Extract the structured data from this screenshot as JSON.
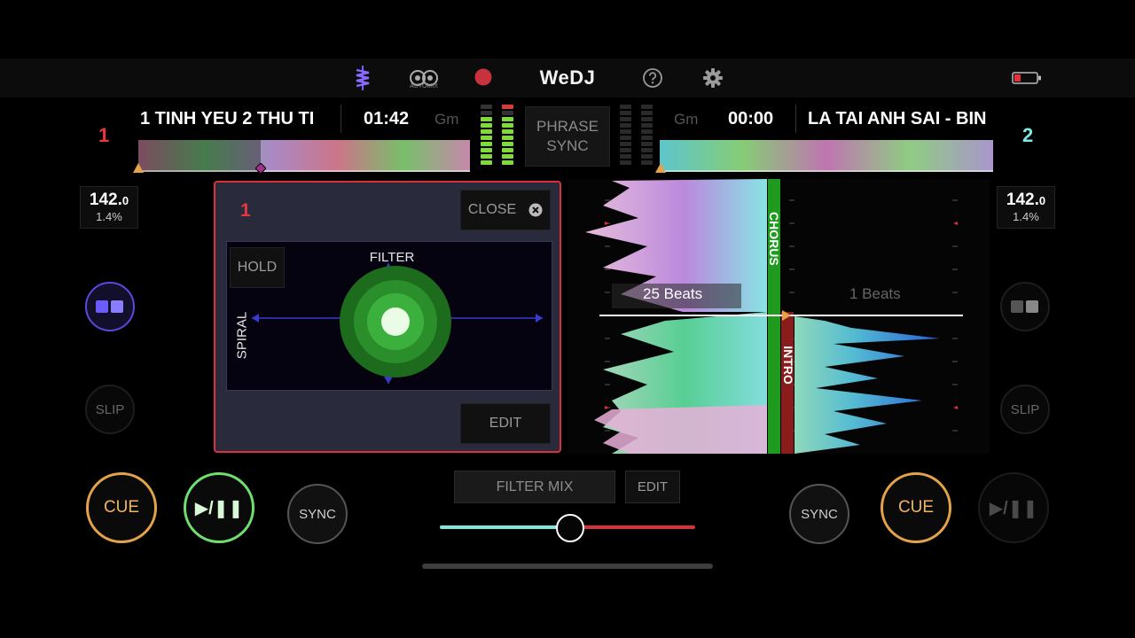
{
  "app": {
    "logo": "WeDJ",
    "automix_label": "AUTOMIX",
    "icons": {
      "waveform": "waveform-icon",
      "automix": "automix-icon",
      "record": "record-icon",
      "help": "help-icon",
      "settings": "gear-icon",
      "battery": "battery-icon"
    },
    "colors": {
      "deck1": "#e8383f",
      "deck2": "#7fe9e0",
      "cue": "#e5a349",
      "play": "#6fe06f",
      "fx_border": "#d7323a"
    }
  },
  "deck1": {
    "number": "1",
    "title": "1 TINH YEU 2 THU TI",
    "time": "01:42",
    "key": "Gm",
    "bpm_int": "142.",
    "bpm_dec": "0",
    "pitch": "1.4%",
    "slip_label": "SLIP",
    "cue_label": "CUE",
    "play_label": "▶/❚❚",
    "sync_label": "SYNC"
  },
  "deck2": {
    "number": "2",
    "title": "LA TAI ANH SAI - BIN",
    "time": "00:00",
    "key": "Gm",
    "bpm_int": "142.",
    "bpm_dec": "0",
    "pitch": "1.4%",
    "slip_label": "SLIP",
    "cue_label": "CUE",
    "play_label": "▶/❚❚",
    "sync_label": "SYNC"
  },
  "phrase_sync": {
    "line1": "PHRASE",
    "line2": "SYNC"
  },
  "fx_panel": {
    "deck_number": "1",
    "close_label": "CLOSE",
    "hold_label": "HOLD",
    "edit_label": "EDIT",
    "y_axis_label": "FILTER",
    "x_axis_label": "SPIRAL"
  },
  "waveform": {
    "left_beats": "25 Beats",
    "right_beats": "1 Beats",
    "left_phrase": "CHORUS",
    "right_phrase": "INTRO"
  },
  "mixer": {
    "filter_mix_label": "FILTER MIX",
    "edit_label": "EDIT",
    "crossfader_position": 0.5
  }
}
